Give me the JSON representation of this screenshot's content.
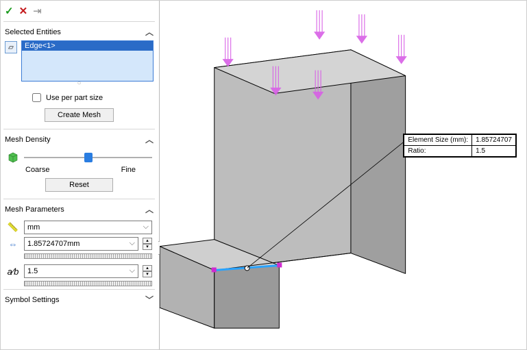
{
  "topbar": {
    "ok": "✓",
    "cancel": "✕",
    "pin": "⇥"
  },
  "sections": {
    "entities": {
      "title": "Selected Entities",
      "expanded": true
    },
    "density": {
      "title": "Mesh Density",
      "expanded": true
    },
    "params": {
      "title": "Mesh Parameters",
      "expanded": true
    },
    "symbol": {
      "title": "Symbol Settings",
      "expanded": false
    }
  },
  "entities": {
    "items": [
      "Edge<1>"
    ]
  },
  "per_part": {
    "label": "Use per part size",
    "checked": false
  },
  "create_btn": "Create Mesh",
  "density": {
    "coarse": "Coarse",
    "fine": "Fine",
    "reset": "Reset",
    "value": 50
  },
  "params": {
    "unit": "mm",
    "size": "1.85724707mm",
    "ratio": "1.5"
  },
  "icons": {
    "entity": "▱",
    "ruler": "📏",
    "size": "⇔",
    "ratio": "a⁄b"
  },
  "callout": {
    "size_label": "Element Size (mm):",
    "size_value": "1.85724707",
    "ratio_label": "Ratio:",
    "ratio_value": "1.5"
  },
  "chart_data": null
}
